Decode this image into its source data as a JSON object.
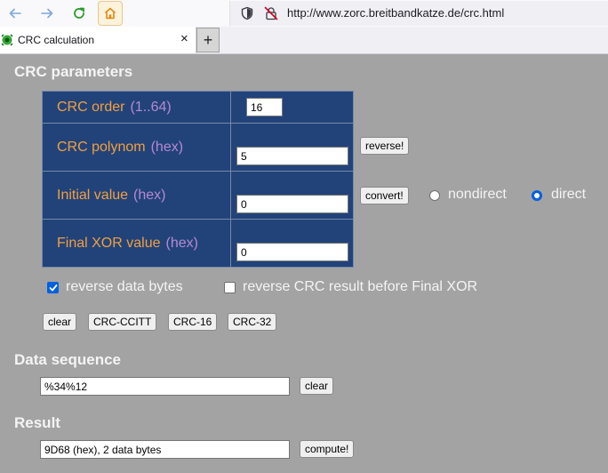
{
  "browser": {
    "url": "http://www.zorc.breitbandkatze.de/crc.html",
    "tab_title": "CRC calculation",
    "tab_close": "×",
    "new_tab": "+"
  },
  "crc_parameters": {
    "heading": "CRC parameters",
    "order": {
      "label": "CRC order",
      "hint": "(1..64)",
      "value": "16"
    },
    "polynom": {
      "label": "CRC polynom",
      "hint": "(hex)",
      "value": "5",
      "button": "reverse!"
    },
    "initial": {
      "label": "Initial value",
      "hint": "(hex)",
      "value": "0",
      "button": "convert!"
    },
    "final_xor": {
      "label": "Final XOR value",
      "hint": "(hex)",
      "value": "0"
    },
    "mode": {
      "nondirect_label": "nondirect",
      "direct_label": "direct",
      "selected": "direct"
    },
    "reverse_data_bytes": {
      "label": "reverse data bytes",
      "checked": true
    },
    "reverse_crc_result": {
      "label": "reverse CRC result before Final XOR",
      "checked": false
    },
    "presets": [
      "clear",
      "CRC-CCITT",
      "CRC-16",
      "CRC-32"
    ]
  },
  "data_sequence": {
    "heading": "Data sequence",
    "value": "%34%12",
    "clear_button": "clear"
  },
  "result": {
    "heading": "Result",
    "value": "9D68 (hex), 2 data bytes",
    "compute_button": "compute!"
  }
}
